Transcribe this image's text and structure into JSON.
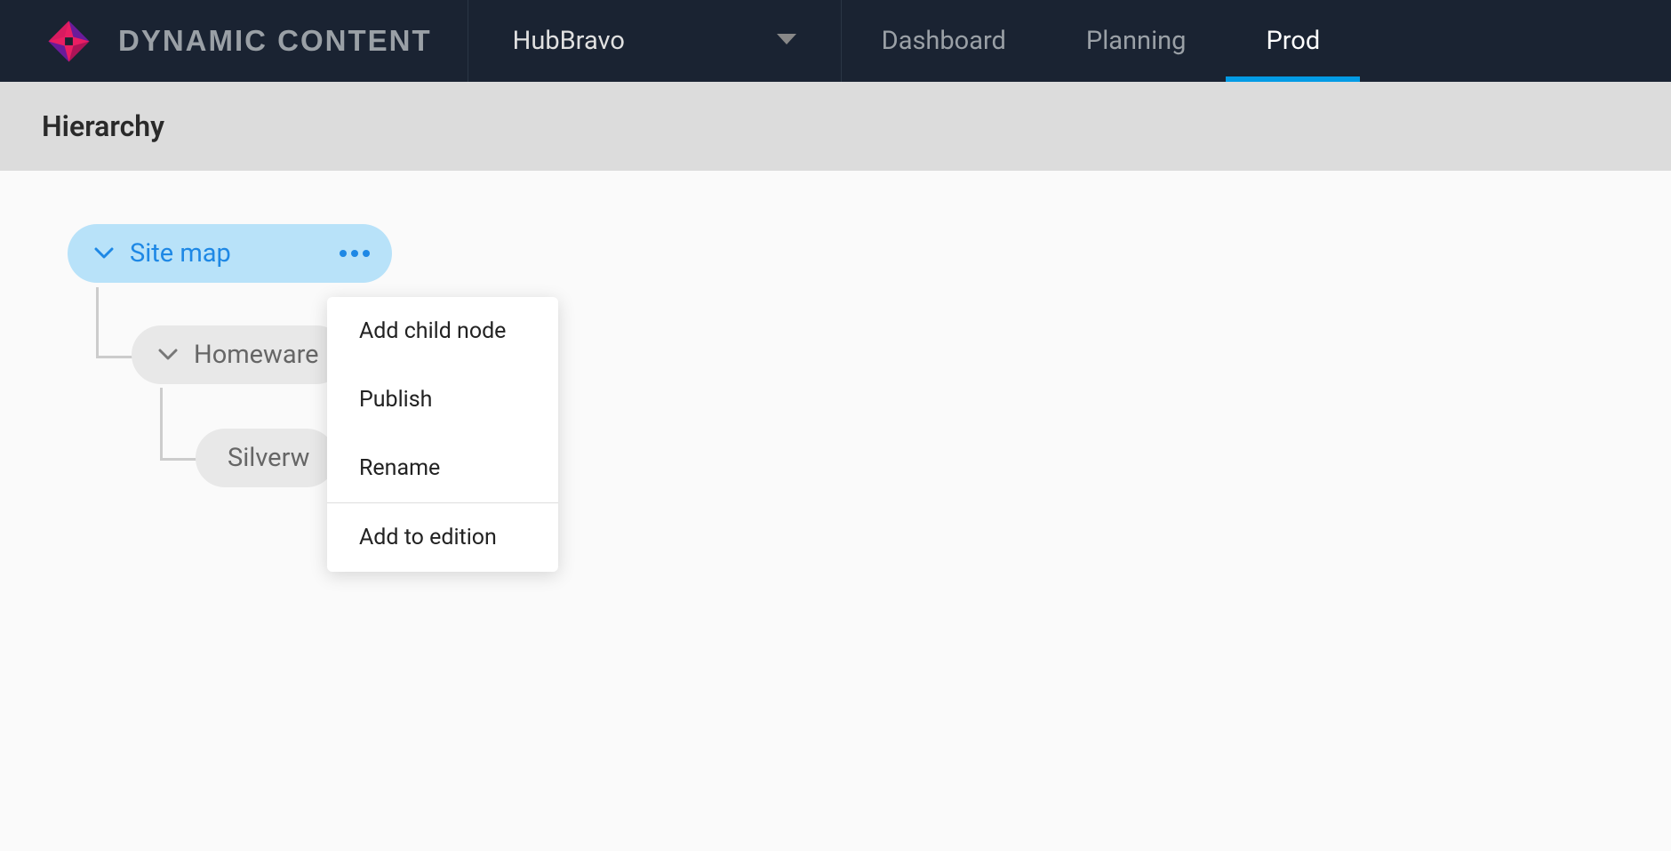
{
  "header": {
    "brand": "DYNAMIC CONTENT",
    "hub": "HubBravo",
    "nav": [
      {
        "label": "Dashboard",
        "active": false
      },
      {
        "label": "Planning",
        "active": false
      },
      {
        "label": "Prod",
        "active": true
      }
    ]
  },
  "subheader": {
    "title": "Hierarchy"
  },
  "tree": {
    "root": {
      "label": "Site map",
      "selected": true
    },
    "child1": {
      "label": "Homeware"
    },
    "child2": {
      "label": "Silverw"
    }
  },
  "context_menu": {
    "items": [
      "Add child node",
      "Publish",
      "Rename",
      "Add to edition"
    ]
  }
}
